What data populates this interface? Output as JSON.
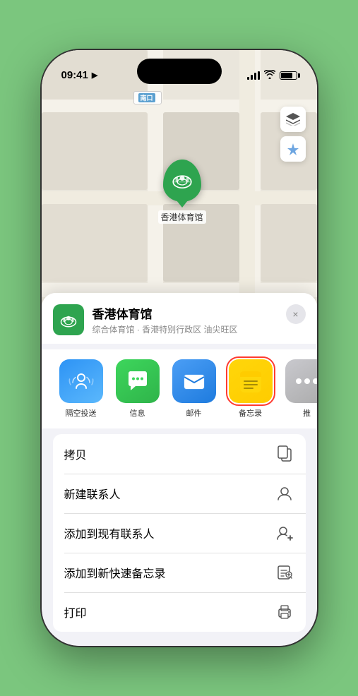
{
  "status_bar": {
    "time": "09:41",
    "location_icon": "▶"
  },
  "map": {
    "label_prefix": "南口",
    "map_ctrl_layer": "🗺",
    "map_ctrl_location": "➤"
  },
  "pin": {
    "label": "香港体育馆"
  },
  "venue": {
    "name": "香港体育馆",
    "description": "综合体育馆 · 香港特别行政区 油尖旺区",
    "close_label": "×"
  },
  "share_items": [
    {
      "id": "airdrop",
      "label": "隔空投送"
    },
    {
      "id": "messages",
      "label": "信息"
    },
    {
      "id": "mail",
      "label": "邮件"
    },
    {
      "id": "notes",
      "label": "备忘录"
    },
    {
      "id": "more",
      "label": "推"
    }
  ],
  "actions": [
    {
      "id": "copy",
      "label": "拷贝",
      "icon": "copy"
    },
    {
      "id": "new-contact",
      "label": "新建联系人",
      "icon": "person"
    },
    {
      "id": "add-contact",
      "label": "添加到现有联系人",
      "icon": "person-add"
    },
    {
      "id": "quick-note",
      "label": "添加到新快速备忘录",
      "icon": "note"
    },
    {
      "id": "print",
      "label": "打印",
      "icon": "print"
    }
  ]
}
